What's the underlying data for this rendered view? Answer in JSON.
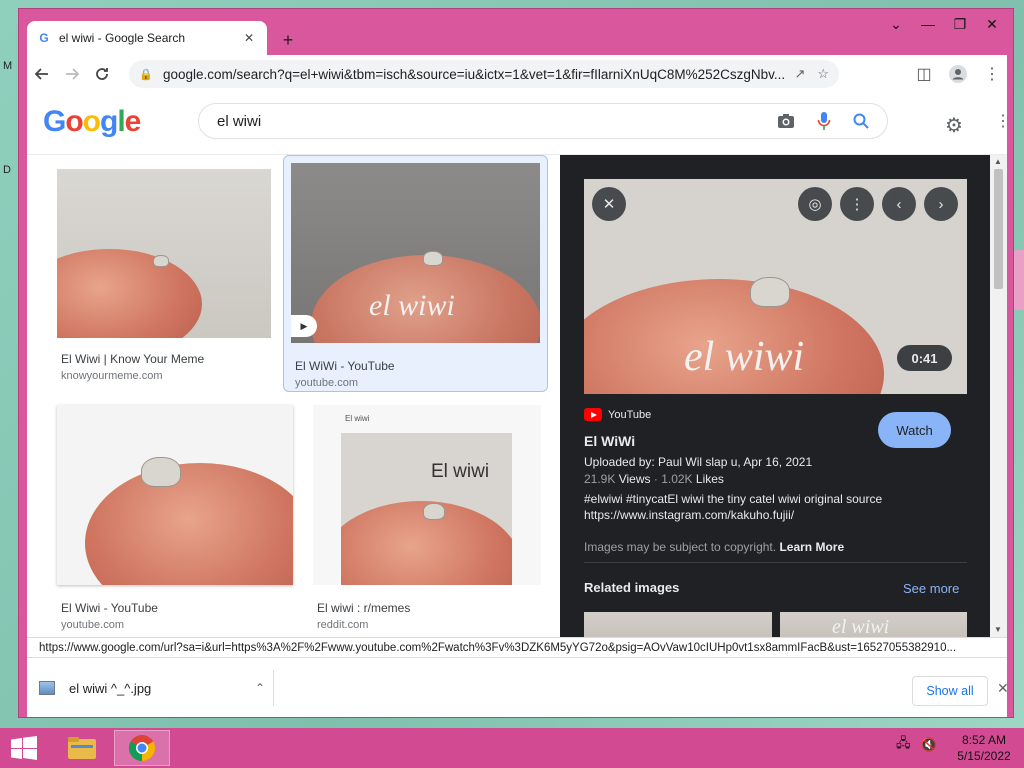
{
  "browser": {
    "tab_title": "el wiwi - Google Search",
    "url": "google.com/search?q=el+wiwi&tbm=isch&source=iu&ictx=1&vet=1&fir=fIlarniXnUqC8M%252CszgNbv...",
    "status_url": "https://www.google.com/url?sa=i&url=https%3A%2F%2Fwww.youtube.com%2Fwatch%3Fv%3DZK6M5yYG72o&psig=AOvVaw10cIUHp0vt1sx8ammIFacB&ust=16527055382910..."
  },
  "google": {
    "logo_letters": [
      "G",
      "o",
      "o",
      "g",
      "l",
      "e"
    ],
    "logo_colors": [
      "#4285f4",
      "#ea4335",
      "#fbbc05",
      "#4285f4",
      "#34a853",
      "#ea4335"
    ],
    "query": "el wiwi"
  },
  "results": [
    {
      "title": "El Wiwi | Know Your Meme",
      "domain": "knowyourmeme.com"
    },
    {
      "title": "El WiWi - YouTube",
      "domain": "youtube.com"
    },
    {
      "title": "El Wiwi - YouTube",
      "domain": "youtube.com"
    },
    {
      "title": "El wiwi : r/memes",
      "domain": "reddit.com"
    }
  ],
  "thumb_texts": {
    "overlay_small": "el wiwi",
    "reddit_caption": "El wiwi",
    "reddit_handwritten": "El wiwi"
  },
  "preview": {
    "overlay_text": "el wiwi",
    "duration": "0:41",
    "source": "YouTube",
    "title": "El WiWi",
    "watch_label": "Watch",
    "uploaded": "Uploaded by: Paul Wil slap u, Apr 16, 2021",
    "views_value": "21.9K",
    "views_label": "Views",
    "likes_value": "1.02K",
    "likes_label": "Likes",
    "desc_line1": "#elwiwi #tinycatEl wiwi the tiny catel wiwi original source",
    "desc_line2": "https://www.instagram.com/kakuho.fujii/",
    "copyright": "Images may be subject to copyright.",
    "learn_more": "Learn More",
    "related_title": "Related images",
    "see_more": "See more",
    "related_thumb_text": "el wiwi"
  },
  "downloads": {
    "file_name": "el wiwi ^_^.jpg",
    "show_all": "Show all"
  },
  "taskbar": {
    "time": "8:52 AM",
    "date": "5/15/2022"
  },
  "desktop": {
    "left_frag_1": "M",
    "left_frag_2": "D"
  },
  "colors": {
    "window_frame": "#d9589d",
    "taskbar": "#d14a92",
    "preview_bg": "#202124",
    "link_blue": "#8ab4f8"
  }
}
